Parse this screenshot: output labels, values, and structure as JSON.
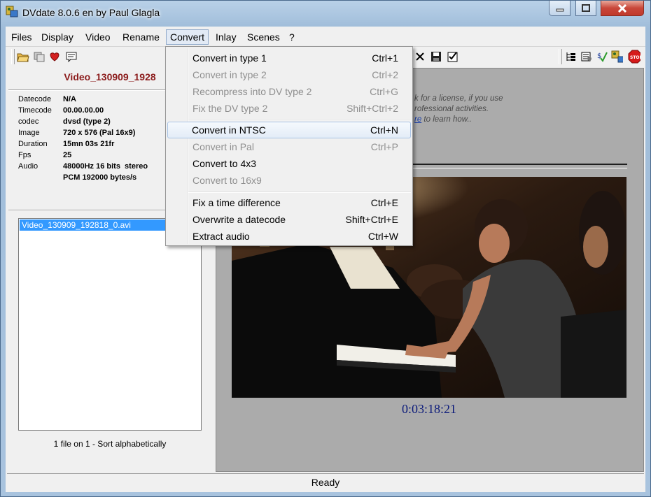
{
  "window": {
    "title": "DVdate 8.0.6 en by Paul Glagla"
  },
  "menubar": {
    "items": [
      {
        "label": "Files"
      },
      {
        "label": "Display"
      },
      {
        "label": "Video"
      },
      {
        "label": "Rename"
      },
      {
        "label": "Convert"
      },
      {
        "label": "Inlay"
      },
      {
        "label": "Scenes"
      },
      {
        "label": "?"
      }
    ]
  },
  "convert_menu": {
    "items": [
      {
        "label": "Convert in type 1",
        "shortcut": "Ctrl+1",
        "enabled": true
      },
      {
        "label": "Convert in type 2",
        "shortcut": "Ctrl+2",
        "enabled": false
      },
      {
        "label": "Recompress into DV type 2",
        "shortcut": "Ctrl+G",
        "enabled": false
      },
      {
        "label": "Fix the DV type 2",
        "shortcut": "Shift+Ctrl+2",
        "enabled": false
      },
      {
        "label": "Convert in NTSC",
        "shortcut": "Ctrl+N",
        "enabled": true,
        "highlighted": true
      },
      {
        "label": "Convert in Pal",
        "shortcut": "Ctrl+P",
        "enabled": false
      },
      {
        "label": "Convert to 4x3",
        "shortcut": "",
        "enabled": true
      },
      {
        "label": "Convert to 16x9",
        "shortcut": "",
        "enabled": false
      },
      {
        "label": "Fix a time difference",
        "shortcut": "Ctrl+E",
        "enabled": true
      },
      {
        "label": "Overwrite a datecode",
        "shortcut": "Shift+Ctrl+E",
        "enabled": true
      },
      {
        "label": "Extract audio",
        "shortcut": "Ctrl+W",
        "enabled": true
      }
    ]
  },
  "video_info": {
    "title": "Video_130909_1928",
    "rows": [
      {
        "key": "Datecode",
        "value": "N/A"
      },
      {
        "key": "Timecode",
        "value": "00.00.00.00"
      },
      {
        "key": "codec",
        "value": "dvsd (type 2)"
      },
      {
        "key": "Image",
        "value": "720 x 576 (Pal 16x9)"
      },
      {
        "key": "Duration",
        "value": "15mn 03s 21fr"
      },
      {
        "key": "Fps",
        "value": "25"
      },
      {
        "key": "Audio",
        "value": "48000Hz 16 bits  stereo"
      },
      {
        "key": "",
        "value": "PCM 192000 bytes/s"
      }
    ]
  },
  "file_list": {
    "items": [
      "Video_130909_192818_0.avi"
    ],
    "status": "1 file on 1 - Sort alphabetically"
  },
  "license": {
    "line1": "k for a license, if you use",
    "line2": "rofessional activities.",
    "line3_link": "re",
    "line3_rest": " to learn how.."
  },
  "player": {
    "timecode": "0:03:18:21"
  },
  "statusbar": {
    "text": "Ready"
  },
  "icons": {
    "toolbar_left": [
      "open-folder-icon",
      "copy-icon",
      "heart-icon",
      "comment-icon"
    ],
    "toolbar_right": [
      "close-x-icon",
      "save-icon",
      "check-icon",
      "tree-icon",
      "properties-icon",
      "spell-check-icon",
      "wrench-icon",
      "stop-icon"
    ]
  },
  "colors": {
    "video_title": "#8b1b1b",
    "timecode": "#0b1a7a",
    "selection": "#3399ff"
  }
}
